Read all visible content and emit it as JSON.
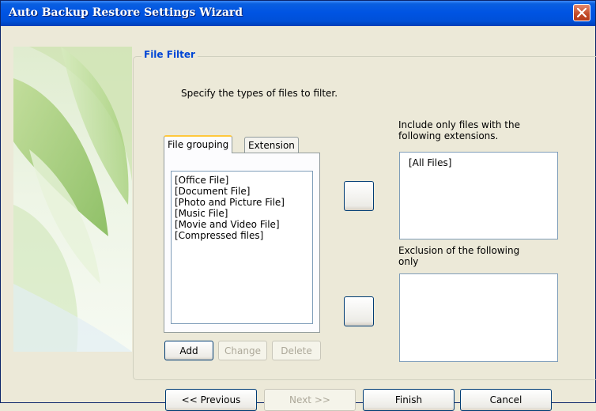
{
  "window": {
    "title": "Auto Backup Restore Settings Wizard"
  },
  "group": {
    "title": "File Filter"
  },
  "instructions": "Specify the types of files to filter.",
  "tabs": [
    {
      "label": "File grouping",
      "active": true
    },
    {
      "label": "Extension",
      "active": false
    }
  ],
  "file_groups": [
    "[Office File]",
    "[Document File]",
    "[Photo and Picture File]",
    "[Music File]",
    "[Movie and Video File]",
    "[Compressed files]"
  ],
  "include": {
    "label_line1": "Include only files with the",
    "label_line2": "following extensions.",
    "items": [
      "[All Files]"
    ]
  },
  "exclude": {
    "label_line1": "Exclusion of the following",
    "label_line2": "only",
    "items": []
  },
  "list_buttons": {
    "add": "Add",
    "change": "Change",
    "delete": "Delete"
  },
  "nav": {
    "previous": "<< Previous",
    "next": "Next >>",
    "finish": "Finish",
    "cancel": "Cancel"
  },
  "colors": {
    "title_bar": "#0054e3",
    "group_title": "#0046d5",
    "tab_highlight": "#ffc83c",
    "close_button": "#c24a28"
  },
  "icons": {
    "close": "close-icon"
  }
}
